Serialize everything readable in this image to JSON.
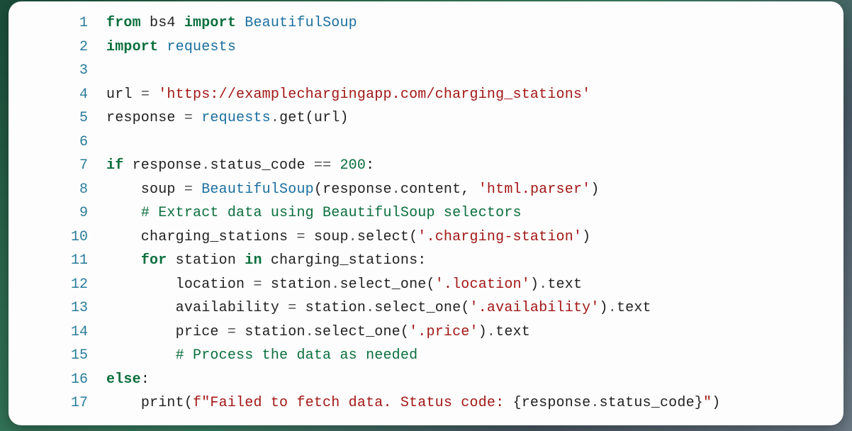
{
  "code": {
    "lines": [
      {
        "num": "1",
        "tokens": [
          {
            "cls": "kw",
            "t": "from"
          },
          {
            "cls": "id",
            "t": " bs4 "
          },
          {
            "cls": "kw",
            "t": "import"
          },
          {
            "cls": "id",
            "t": " "
          },
          {
            "cls": "cls",
            "t": "BeautifulSoup"
          }
        ]
      },
      {
        "num": "2",
        "tokens": [
          {
            "cls": "kw",
            "t": "import"
          },
          {
            "cls": "id",
            "t": " "
          },
          {
            "cls": "mod",
            "t": "requests"
          }
        ]
      },
      {
        "num": "3",
        "tokens": []
      },
      {
        "num": "4",
        "tokens": [
          {
            "cls": "id",
            "t": "url "
          },
          {
            "cls": "op",
            "t": "="
          },
          {
            "cls": "id",
            "t": " "
          },
          {
            "cls": "str",
            "t": "'https://examplechargingapp.com/charging_stations'"
          }
        ]
      },
      {
        "num": "5",
        "tokens": [
          {
            "cls": "id",
            "t": "response "
          },
          {
            "cls": "op",
            "t": "="
          },
          {
            "cls": "id",
            "t": " "
          },
          {
            "cls": "mod",
            "t": "requests"
          },
          {
            "cls": "op",
            "t": "."
          },
          {
            "cls": "fn",
            "t": "get"
          },
          {
            "cls": "pun",
            "t": "("
          },
          {
            "cls": "id",
            "t": "url"
          },
          {
            "cls": "pun",
            "t": ")"
          }
        ]
      },
      {
        "num": "6",
        "tokens": []
      },
      {
        "num": "7",
        "tokens": [
          {
            "cls": "kw",
            "t": "if"
          },
          {
            "cls": "id",
            "t": " response"
          },
          {
            "cls": "op",
            "t": "."
          },
          {
            "cls": "id",
            "t": "status_code "
          },
          {
            "cls": "op",
            "t": "=="
          },
          {
            "cls": "id",
            "t": " "
          },
          {
            "cls": "num",
            "t": "200"
          },
          {
            "cls": "pun",
            "t": ":"
          }
        ]
      },
      {
        "num": "8",
        "tokens": [
          {
            "cls": "id",
            "t": "    soup "
          },
          {
            "cls": "op",
            "t": "="
          },
          {
            "cls": "id",
            "t": " "
          },
          {
            "cls": "cls",
            "t": "BeautifulSoup"
          },
          {
            "cls": "pun",
            "t": "("
          },
          {
            "cls": "id",
            "t": "response"
          },
          {
            "cls": "op",
            "t": "."
          },
          {
            "cls": "id",
            "t": "content"
          },
          {
            "cls": "pun",
            "t": ", "
          },
          {
            "cls": "str",
            "t": "'html.parser'"
          },
          {
            "cls": "pun",
            "t": ")"
          }
        ]
      },
      {
        "num": "9",
        "tokens": [
          {
            "cls": "id",
            "t": "    "
          },
          {
            "cls": "cmt",
            "t": "# Extract data using BeautifulSoup selectors"
          }
        ]
      },
      {
        "num": "10",
        "tokens": [
          {
            "cls": "id",
            "t": "    charging_stations "
          },
          {
            "cls": "op",
            "t": "="
          },
          {
            "cls": "id",
            "t": " soup"
          },
          {
            "cls": "op",
            "t": "."
          },
          {
            "cls": "fn",
            "t": "select"
          },
          {
            "cls": "pun",
            "t": "("
          },
          {
            "cls": "str",
            "t": "'.charging-station'"
          },
          {
            "cls": "pun",
            "t": ")"
          }
        ]
      },
      {
        "num": "11",
        "tokens": [
          {
            "cls": "id",
            "t": "    "
          },
          {
            "cls": "kw",
            "t": "for"
          },
          {
            "cls": "id",
            "t": " station "
          },
          {
            "cls": "kw",
            "t": "in"
          },
          {
            "cls": "id",
            "t": " charging_stations"
          },
          {
            "cls": "pun",
            "t": ":"
          }
        ]
      },
      {
        "num": "12",
        "tokens": [
          {
            "cls": "id",
            "t": "        location "
          },
          {
            "cls": "op",
            "t": "="
          },
          {
            "cls": "id",
            "t": " station"
          },
          {
            "cls": "op",
            "t": "."
          },
          {
            "cls": "fn",
            "t": "select_one"
          },
          {
            "cls": "pun",
            "t": "("
          },
          {
            "cls": "str",
            "t": "'.location'"
          },
          {
            "cls": "pun",
            "t": ")"
          },
          {
            "cls": "op",
            "t": "."
          },
          {
            "cls": "id",
            "t": "text"
          }
        ]
      },
      {
        "num": "13",
        "tokens": [
          {
            "cls": "id",
            "t": "        availability "
          },
          {
            "cls": "op",
            "t": "="
          },
          {
            "cls": "id",
            "t": " station"
          },
          {
            "cls": "op",
            "t": "."
          },
          {
            "cls": "fn",
            "t": "select_one"
          },
          {
            "cls": "pun",
            "t": "("
          },
          {
            "cls": "str",
            "t": "'.availability'"
          },
          {
            "cls": "pun",
            "t": ")"
          },
          {
            "cls": "op",
            "t": "."
          },
          {
            "cls": "id",
            "t": "text"
          }
        ]
      },
      {
        "num": "14",
        "tokens": [
          {
            "cls": "id",
            "t": "        price "
          },
          {
            "cls": "op",
            "t": "="
          },
          {
            "cls": "id",
            "t": " station"
          },
          {
            "cls": "op",
            "t": "."
          },
          {
            "cls": "fn",
            "t": "select_one"
          },
          {
            "cls": "pun",
            "t": "("
          },
          {
            "cls": "str",
            "t": "'.price'"
          },
          {
            "cls": "pun",
            "t": ")"
          },
          {
            "cls": "op",
            "t": "."
          },
          {
            "cls": "id",
            "t": "text"
          }
        ]
      },
      {
        "num": "15",
        "tokens": [
          {
            "cls": "id",
            "t": "        "
          },
          {
            "cls": "cmt",
            "t": "# Process the data as needed"
          }
        ]
      },
      {
        "num": "16",
        "tokens": [
          {
            "cls": "kw",
            "t": "else"
          },
          {
            "cls": "pun",
            "t": ":"
          }
        ]
      },
      {
        "num": "17",
        "tokens": [
          {
            "cls": "id",
            "t": "    "
          },
          {
            "cls": "fn",
            "t": "print"
          },
          {
            "cls": "pun",
            "t": "("
          },
          {
            "cls": "str",
            "t": "f\"Failed to fetch data. Status code: "
          },
          {
            "cls": "pun",
            "t": "{"
          },
          {
            "cls": "fid",
            "t": "response"
          },
          {
            "cls": "op",
            "t": "."
          },
          {
            "cls": "fid",
            "t": "status_code"
          },
          {
            "cls": "pun",
            "t": "}"
          },
          {
            "cls": "str",
            "t": "\""
          },
          {
            "cls": "pun",
            "t": ")"
          }
        ]
      }
    ]
  }
}
